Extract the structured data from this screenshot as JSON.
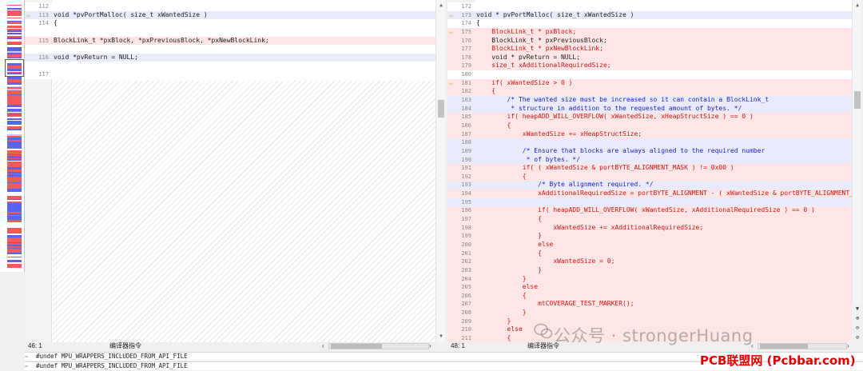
{
  "left_pane": {
    "lines": [
      {
        "n": "112",
        "text": "",
        "style": "nm",
        "arrow": false
      },
      {
        "n": "113",
        "text": "void *pvPortMalloc( size_t xWantedSize )",
        "style": "pl",
        "arrow": true
      },
      {
        "n": "114",
        "text": "{",
        "style": "nm",
        "arrow": false
      },
      {
        "n": "",
        "text": "",
        "style": "nm",
        "arrow": false
      },
      {
        "n": "115",
        "text": "BlockLink_t *pxBlock, *pxPreviousBlock, *pxNewBlockLink;",
        "style": "ck",
        "arrow": false
      },
      {
        "n": "",
        "text": "",
        "style": "nm",
        "arrow": false
      },
      {
        "n": "116",
        "text": "void *pvReturn = NULL;",
        "style": "pl",
        "arrow": false
      },
      {
        "n": "",
        "text": "",
        "style": "nm",
        "arrow": false
      },
      {
        "n": "117",
        "text": "",
        "style": "nm",
        "arrow": false
      }
    ],
    "status": {
      "position": "46: 1",
      "mode": "编译器指令"
    }
  },
  "right_pane": {
    "lines": [
      {
        "n": "172",
        "text": "",
        "style": "nm",
        "arrow": false
      },
      {
        "n": "173",
        "text": "void * pvPortMalloc( size_t xWantedSize )",
        "style": "pl",
        "arrow": true
      },
      {
        "n": "174",
        "text": "{",
        "style": "nm",
        "arrow": false
      },
      {
        "n": "175",
        "text": "    BlockLink_t * pxBlock;",
        "style": "ch",
        "arrow": true
      },
      {
        "n": "176",
        "text": "    BlockLink_t * pxPreviousBlock;",
        "style": "ck",
        "arrow": false
      },
      {
        "n": "177",
        "text": "    BlockLink_t * pxNewBlockLink;",
        "style": "ch",
        "arrow": false
      },
      {
        "n": "178",
        "text": "    void * pvReturn = NULL;",
        "style": "ck",
        "arrow": false
      },
      {
        "n": "179",
        "text": "    size_t xAdditionalRequiredSize;",
        "style": "ch",
        "arrow": false
      },
      {
        "n": "180",
        "text": "",
        "style": "nm",
        "arrow": false
      },
      {
        "n": "181",
        "text": "    if( xWantedSize > 0 )",
        "style": "ch",
        "arrow": true
      },
      {
        "n": "182",
        "text": "    {",
        "style": "ch",
        "arrow": false
      },
      {
        "n": "183",
        "text": "        /* The wanted size must be increased so it can contain a BlockLink_t",
        "style": "bl",
        "arrow": false
      },
      {
        "n": "184",
        "text": "         * structure in addition to the requested amount of bytes. */",
        "style": "bl",
        "arrow": false
      },
      {
        "n": "185",
        "text": "        if( heapADD_WILL_OVERFLOW( xWantedSize, xHeapStructSize ) == 0 )",
        "style": "ch",
        "arrow": false
      },
      {
        "n": "186",
        "text": "        {",
        "style": "ch",
        "arrow": false
      },
      {
        "n": "187",
        "text": "            xWantedSize += xHeapStructSize;",
        "style": "ch",
        "arrow": false
      },
      {
        "n": "188",
        "text": "",
        "style": "bl",
        "arrow": false
      },
      {
        "n": "189",
        "text": "            /* Ensure that blocks are always aligned to the required number",
        "style": "bl",
        "arrow": false
      },
      {
        "n": "190",
        "text": "             * of bytes. */",
        "style": "bl",
        "arrow": false
      },
      {
        "n": "191",
        "text": "            if( ( xWantedSize & portBYTE_ALIGNMENT_MASK ) != 0x00 )",
        "style": "ch",
        "arrow": false
      },
      {
        "n": "192",
        "text": "            {",
        "style": "ch",
        "arrow": false
      },
      {
        "n": "193",
        "text": "                /* Byte alignment required. */",
        "style": "bl",
        "arrow": false
      },
      {
        "n": "194",
        "text": "                xAdditionalRequiredSize = portBYTE_ALIGNMENT - ( xWantedSize & portBYTE_ALIGNMENT_MASK );",
        "style": "ch",
        "arrow": false
      },
      {
        "n": "195",
        "text": "",
        "style": "bl",
        "arrow": false
      },
      {
        "n": "196",
        "text": "                if( heapADD_WILL_OVERFLOW( xWantedSize, xAdditionalRequiredSize ) == 0 )",
        "style": "ch",
        "arrow": false
      },
      {
        "n": "197",
        "text": "                {",
        "style": "ch",
        "arrow": false
      },
      {
        "n": "198",
        "text": "                    xWantedSize += xAdditionalRequiredSize;",
        "style": "ch",
        "arrow": false
      },
      {
        "n": "199",
        "text": "                }",
        "style": "ch",
        "arrow": false
      },
      {
        "n": "200",
        "text": "                else",
        "style": "ch",
        "arrow": false
      },
      {
        "n": "201",
        "text": "                {",
        "style": "ch",
        "arrow": false
      },
      {
        "n": "202",
        "text": "                    xWantedSize = 0;",
        "style": "ch",
        "arrow": false
      },
      {
        "n": "203",
        "text": "                }",
        "style": "ch",
        "arrow": false
      },
      {
        "n": "204",
        "text": "            }",
        "style": "ch",
        "arrow": false
      },
      {
        "n": "205",
        "text": "            else",
        "style": "ch",
        "arrow": false
      },
      {
        "n": "206",
        "text": "            {",
        "style": "ch",
        "arrow": false
      },
      {
        "n": "207",
        "text": "                mtCOVERAGE_TEST_MARKER();",
        "style": "ch",
        "arrow": false
      },
      {
        "n": "208",
        "text": "            }",
        "style": "ch",
        "arrow": false
      },
      {
        "n": "209",
        "text": "        }",
        "style": "ch",
        "arrow": false
      },
      {
        "n": "210",
        "text": "        else",
        "style": "ch",
        "arrow": false
      },
      {
        "n": "211",
        "text": "        {",
        "style": "ch",
        "arrow": false
      }
    ],
    "status": {
      "position": "48: 1",
      "mode": "编译器指令"
    }
  },
  "bottom_rows": [
    {
      "text": "#undef MPU_WRAPPERS_INCLUDED_FROM_API_FILE",
      "icon": "swap-arrow-icon"
    },
    {
      "text": "#undef MPU_WRAPPERS_INCLUDED_FROM_API_FILE",
      "icon": "swap-arrow-icon"
    }
  ],
  "watermarks": {
    "author": "公众号 · strongerHuang",
    "site": "PCB联盟网 (Pcbbar.com)"
  },
  "colors": {
    "changed_bg": "#ffe6e6",
    "changed_text": "#d31515",
    "comment_bg": "#e9ebfb",
    "comment_text": "#1e1ec8",
    "arrow": "#d4a017"
  }
}
